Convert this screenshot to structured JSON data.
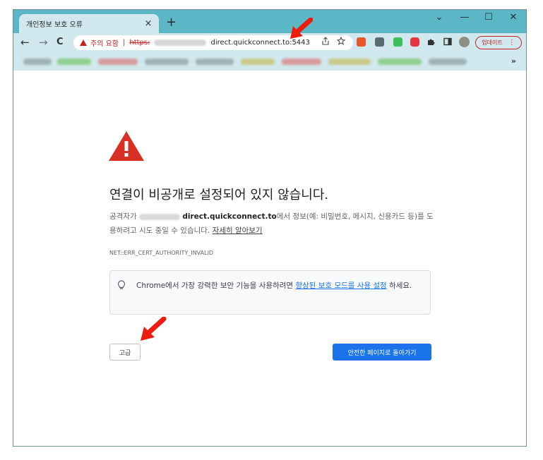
{
  "browser": {
    "tab_title": "개인정보 보호 오류",
    "tab_close": "×",
    "new_tab": "+",
    "window_controls": {
      "minimize": "—",
      "maximize": "☐",
      "close": "✕",
      "menu": "⌄"
    },
    "nav": {
      "back": "←",
      "forward": "→",
      "reload": "C"
    },
    "address": {
      "security_label": "주의 요함",
      "separator": "|",
      "scheme": "https:",
      "host": "direct.quickconnect.to",
      "port": ":5443"
    },
    "update_label": "업데이트",
    "update_menu": "⋮",
    "bookmarks_more": "»"
  },
  "page": {
    "heading": "연결이 비공개로 설정되어 있지 않습니다.",
    "body_prefix": "공격자가",
    "body_host": "direct.quickconnect.to",
    "body_suffix": "에서 정보(예: 비밀번호, 메시지, 신용카드 등)를 도용하려고 시도 중일 수 있습니다.",
    "learn_more": "자세히 알아보기",
    "error_code": "NET::ERR_CERT_AUTHORITY_INVALID",
    "info_text": "Chrome에서 가장 강력한 보안 기능을 사용하려면",
    "info_link": "향상된 보호 모드를 사용 설정",
    "info_suffix": "하세요.",
    "advanced_button": "고급",
    "back_button": "안전한 페이지로 돌아가기"
  },
  "colors": {
    "titlebar": "#5bb7c6",
    "toolbar": "#d1e9ee",
    "warning_red": "#c5221f",
    "primary_blue": "#1a73e8",
    "annotation_arrow": "#ee1c0f"
  },
  "icons": [
    "share-icon",
    "star-icon",
    "extensions-puzzle-icon",
    "sidepanel-icon",
    "profile-avatar",
    "lightbulb-icon",
    "warning-triangle-icon"
  ]
}
